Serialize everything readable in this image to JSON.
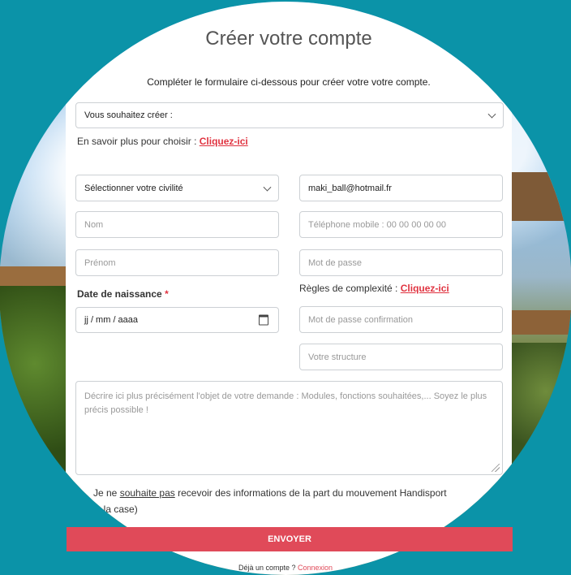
{
  "page": {
    "title": "Créer votre compte",
    "subtitle": "Compléter le formulaire ci-dessous pour créer votre votre compte."
  },
  "account_type": {
    "placeholder": "Vous souhaitez créer :"
  },
  "learn_more": {
    "text": "En savoir plus pour choisir : ",
    "link": "Cliquez-ici"
  },
  "form": {
    "civility": "Sélectionner votre civilité",
    "email": "maki_ball@hotmail.fr",
    "nom_placeholder": "Nom",
    "phone_placeholder": "Téléphone mobile : 00 00 00 00 00",
    "prenom_placeholder": "Prénom",
    "password_placeholder": "Mot de passe",
    "birth_label": "Date de naissance",
    "required_mark": "*",
    "birth_value": "jj / mm / aaaa",
    "rules_text": "Règles de complexité : ",
    "rules_link": "Cliquez-ici",
    "password_confirm_placeholder": "Mot de passe confirmation",
    "structure_placeholder": "Votre structure",
    "message_placeholder": "Décrire ici plus précisément l'objet de votre demande : Modules, fonctions souhaitées,... Soyez le plus précis possible !"
  },
  "consent": {
    "line1_pre": "Je ne ",
    "line1_link": "souhaite pas",
    "line1_post": " recevoir des informations de la part du mouvement Handisport",
    "line2": "cher la case)"
  },
  "submit": {
    "label": "ENVOYER"
  },
  "footer": {
    "text": "Déjà un compte ? ",
    "link": "Connexion"
  },
  "colors": {
    "background": "#0b93a8",
    "accent": "#e04a59",
    "link_red": "#e03340"
  }
}
